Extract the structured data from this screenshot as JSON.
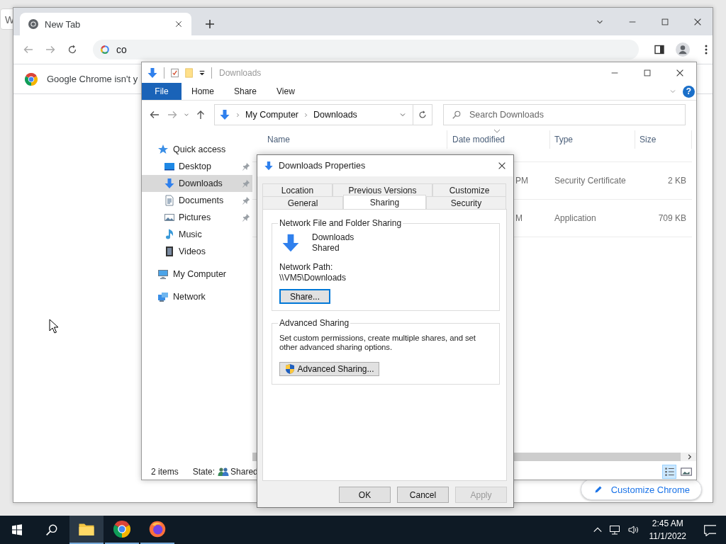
{
  "background_window": {
    "title": "W"
  },
  "browser": {
    "tabs": [
      {
        "title": "New Tab",
        "selected": true
      }
    ],
    "omnibox": {
      "value": "co"
    },
    "infobar": {
      "message": "Google Chrome isn't y"
    },
    "customize_button": {
      "label": "Customize Chrome"
    }
  },
  "explorer": {
    "title": "Downloads",
    "ribbon_tabs": [
      {
        "label": "File",
        "kind": "menu"
      },
      {
        "label": "Home",
        "kind": "tab"
      },
      {
        "label": "Share",
        "kind": "tab"
      },
      {
        "label": "View",
        "kind": "tab"
      }
    ],
    "help_button": "?",
    "breadcrumb": [
      "My Computer",
      "Downloads"
    ],
    "search": {
      "placeholder": "Search Downloads"
    },
    "nav": [
      {
        "label": "Quick access",
        "kind": "star",
        "selected": false,
        "children": [
          {
            "label": "Desktop",
            "kind": "desktop",
            "pinned": true,
            "selected": false
          },
          {
            "label": "Downloads",
            "kind": "download",
            "pinned": true,
            "selected": true
          },
          {
            "label": "Documents",
            "kind": "documents",
            "pinned": true,
            "selected": false
          },
          {
            "label": "Pictures",
            "kind": "pictures",
            "pinned": true,
            "selected": false
          },
          {
            "label": "Music",
            "kind": "music",
            "pinned": false,
            "selected": false
          },
          {
            "label": "Videos",
            "kind": "videos",
            "pinned": false,
            "selected": false
          }
        ]
      },
      {
        "label": "My Computer",
        "kind": "computer",
        "selected": false
      },
      {
        "label": "Network",
        "kind": "network",
        "selected": false
      }
    ],
    "columns": [
      "Name",
      "Date modified",
      "Type",
      "Size"
    ],
    "rows": [
      {
        "date_modified": "PM",
        "type": "Security Certificate",
        "size": "2 KB"
      },
      {
        "date_modified": "M",
        "type": "Application",
        "size": "709 KB"
      }
    ],
    "status_bar": {
      "count": "2 items",
      "state_label": "State:",
      "state": "Shared"
    },
    "view_buttons": [
      {
        "kind": "details",
        "selected": true
      },
      {
        "kind": "tiles",
        "selected": false
      }
    ]
  },
  "dialog": {
    "title": "Downloads Properties",
    "tab_rows": [
      [
        {
          "label": "Location",
          "selected": false
        },
        {
          "label": "Previous Versions",
          "selected": false
        },
        {
          "label": "Customize",
          "selected": false
        }
      ],
      [
        {
          "label": "General",
          "selected": false
        },
        {
          "label": "Sharing",
          "selected": true
        },
        {
          "label": "Security",
          "selected": false
        }
      ]
    ],
    "network_sharing": {
      "heading": "Network File and Folder Sharing",
      "folder_name": "Downloads",
      "share_state": "Shared",
      "path_label": "Network Path:",
      "path": "\\\\VM5\\Downloads",
      "share_button": {
        "label": "Share...",
        "focused": true
      }
    },
    "advanced_sharing": {
      "heading": "Advanced Sharing",
      "description": "Set custom permissions, create multiple shares, and set other advanced sharing options.",
      "button": {
        "label": "Advanced Sharing..."
      }
    },
    "buttons": [
      {
        "label": "OK",
        "disabled": false
      },
      {
        "label": "Cancel",
        "disabled": false
      },
      {
        "label": "Apply",
        "disabled": true
      }
    ]
  },
  "taskbar": {
    "apps": [
      {
        "kind": "explorer",
        "selected": true
      },
      {
        "kind": "chrome",
        "selected": false
      },
      {
        "kind": "firefox",
        "selected": false
      }
    ],
    "time": "2:45 AM",
    "date": "11/1/2022"
  }
}
